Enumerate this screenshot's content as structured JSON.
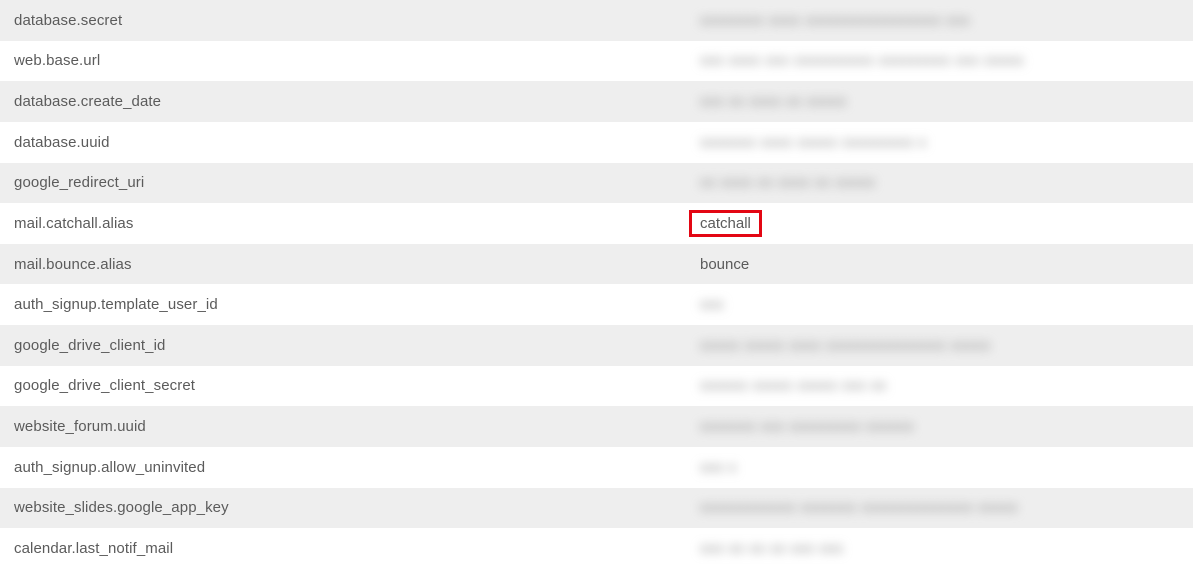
{
  "rows": [
    {
      "key": "database.secret",
      "blurred": true,
      "highlighted": false,
      "value_placeholder": "xxxxxxxx xxxx xxxxxxxxxxxxxxxxx xxx"
    },
    {
      "key": "web.base.url",
      "blurred": true,
      "highlighted": false,
      "value_placeholder": "xxx xxxx xxx xxxxxxxxxx xxxxxxxxx xxx xxxxx"
    },
    {
      "key": "database.create_date",
      "blurred": true,
      "highlighted": false,
      "value_placeholder": "xxx xx xxxx xx xxxxx"
    },
    {
      "key": "database.uuid",
      "blurred": true,
      "highlighted": false,
      "value_placeholder": "xxxxxxx xxxx xxxxx xxxxxxxxx x"
    },
    {
      "key": "google_redirect_uri",
      "blurred": true,
      "highlighted": false,
      "value_placeholder": "xx xxxx xx xxxx xx xxxxx"
    },
    {
      "key": "mail.catchall.alias",
      "blurred": false,
      "highlighted": true,
      "value": "catchall"
    },
    {
      "key": "mail.bounce.alias",
      "blurred": false,
      "highlighted": false,
      "value": "bounce"
    },
    {
      "key": "auth_signup.template_user_id",
      "blurred": true,
      "highlighted": false,
      "value_placeholder": "xxx"
    },
    {
      "key": "google_drive_client_id",
      "blurred": true,
      "highlighted": false,
      "value_placeholder": "xxxxx xxxxx xxxx xxxxxxxxxxxxxxx xxxxx"
    },
    {
      "key": "google_drive_client_secret",
      "blurred": true,
      "highlighted": false,
      "value_placeholder": "xxxxxx xxxxx xxxxx xxx xx"
    },
    {
      "key": "website_forum.uuid",
      "blurred": true,
      "highlighted": false,
      "value_placeholder": "xxxxxxx xxx xxxxxxxxx xxxxxx"
    },
    {
      "key": "auth_signup.allow_uninvited",
      "blurred": true,
      "highlighted": false,
      "value_placeholder": "xxx x"
    },
    {
      "key": "website_slides.google_app_key",
      "blurred": true,
      "highlighted": false,
      "value_placeholder": "xxxxxxxxxxxx xxxxxxx xxxxxxxxxxxxxx xxxxx"
    },
    {
      "key": "calendar.last_notif_mail",
      "blurred": true,
      "highlighted": false,
      "value_placeholder": "xxx xx xx xx xxx xxx"
    }
  ]
}
